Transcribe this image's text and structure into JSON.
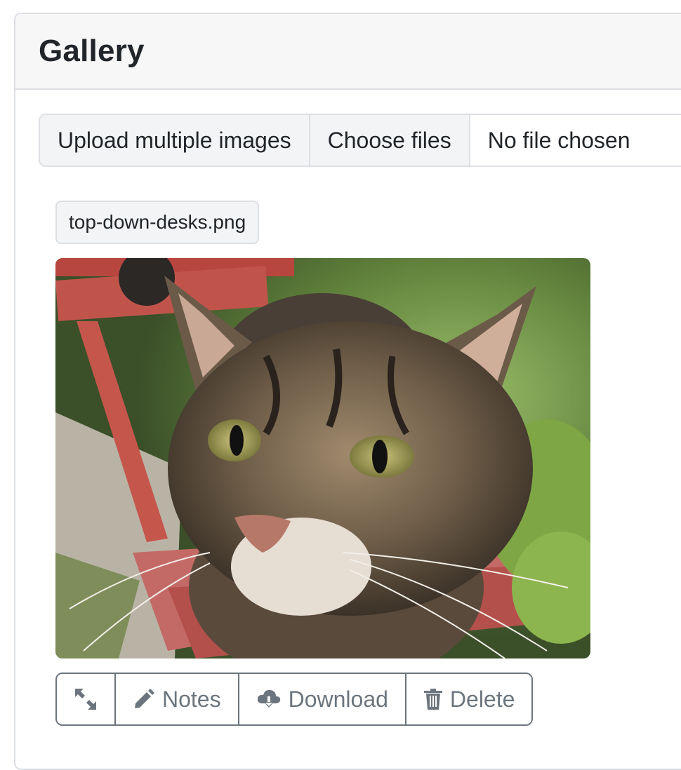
{
  "gallery": {
    "title": "Gallery"
  },
  "upload": {
    "label": "Upload multiple images",
    "choose_button": "Choose files",
    "status": "No file chosen"
  },
  "image": {
    "filename": "top-down-desks.png"
  },
  "actions": {
    "expand_icon": "expand-arrows-icon",
    "notes_icon": "pencil-icon",
    "notes_label": "Notes",
    "download_icon": "cloud-download-icon",
    "download_label": "Download",
    "delete_icon": "trash-icon",
    "delete_label": "Delete"
  },
  "colors": {
    "header_bg": "#f7f7f7",
    "border": "#dcdfe3",
    "button_outline": "#6c757d",
    "text": "#212529"
  }
}
